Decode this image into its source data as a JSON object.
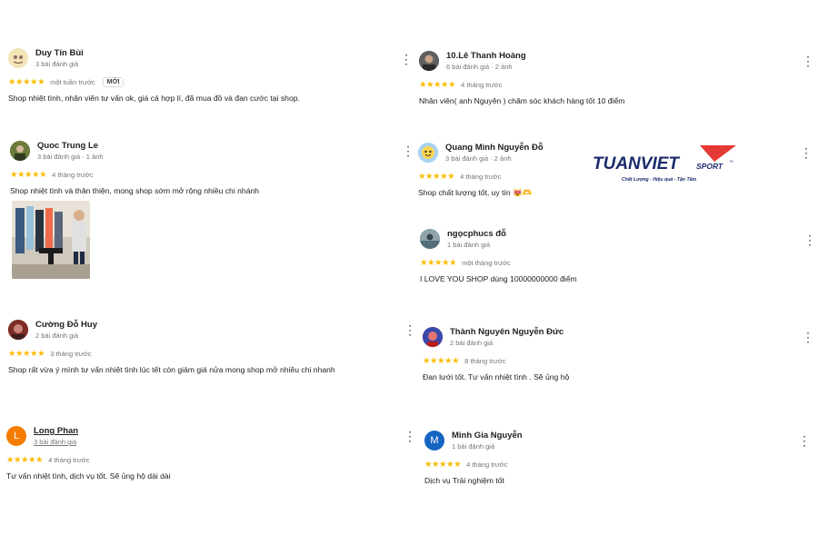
{
  "reviews": [
    {
      "name": "Duy Tín Bùi",
      "meta": "3 bài đánh giá",
      "stars": "★★★★★",
      "when": "một tuần trước",
      "badge": "MỚI",
      "text": "Shop nhiệt tình, nhân viên tư vấn ok, giá cả hợp lí, đã mua đồ và đan cước tại shop."
    },
    {
      "name": "Quoc Trung Le",
      "meta": "3 bài đánh giá · 1 ảnh",
      "stars": "★★★★★",
      "when": "4 tháng trước",
      "text": "Shop nhiệt tình và thân thiện, mong shop sớm mở rộng nhiều chi nhánh"
    },
    {
      "name": "Cường Đỗ Huy",
      "meta": "2 bài đánh giá",
      "stars": "★★★★★",
      "when": "3 tháng trước",
      "text": "Shop rất vừa ý mình tư vấn nhiệt tình lúc tết còn giảm giá nửa mong shop mở nhiều chi nhanh"
    },
    {
      "name": "Long Phan",
      "meta": "3 bài đánh giá",
      "stars": "★★★★★",
      "when": "4 tháng trước",
      "text": "Tư vấn nhiệt tình, dịch vụ tốt. Sẽ ủng hộ dài dài",
      "avatar_letter": "L"
    },
    {
      "name": "10.Lê Thanh Hoàng",
      "meta": "6 bài đánh giá · 2 ảnh",
      "stars": "★★★★★",
      "when": "4 tháng trước",
      "text": "Nhân viên( anh Nguyên ) chăm sóc khách hàng tốt 10 điểm"
    },
    {
      "name": "Quang Minh Nguyễn Đỗ",
      "meta": "3 bài đánh giá · 2 ảnh",
      "stars": "★★★★★",
      "when": "4 tháng trước",
      "text": "Shop chất lượng tốt, uy tín 😻🫶"
    },
    {
      "name": "ngọcphucs đỗ",
      "meta": "1 bài đánh giá",
      "stars": "★★★★★",
      "when": "một tháng trước",
      "text": "I LOVE YOU SHOP dùng 10000000000 điểm"
    },
    {
      "name": "Thành Nguyên Nguyễn Đức",
      "meta": "2 bài đánh giá",
      "stars": "★★★★★",
      "when": "8 tháng trước",
      "text": "Đan lưới tốt. Tư vấn nhiệt tình . Sẽ ủng hộ"
    },
    {
      "name": "Minh Gia Nguyễn",
      "meta": "1 bài đánh giá",
      "stars": "★★★★★",
      "when": "4 tháng trước",
      "text": "Dịch vụ Trải nghiệm tốt",
      "avatar_letter": "M"
    }
  ],
  "logo": {
    "brand": "TUANVIET",
    "suffix": "SPORT",
    "tm": "™",
    "tagline": "Chất Lượng - Hiệu quả - Tận Tâm"
  },
  "menu_glyph": "⋮",
  "colors": {
    "star": "#fbbc04",
    "avatar_long": "#f57c00",
    "avatar_minh": "#1565c0",
    "logo_navy": "#1b2a6b",
    "logo_red": "#e53935"
  }
}
